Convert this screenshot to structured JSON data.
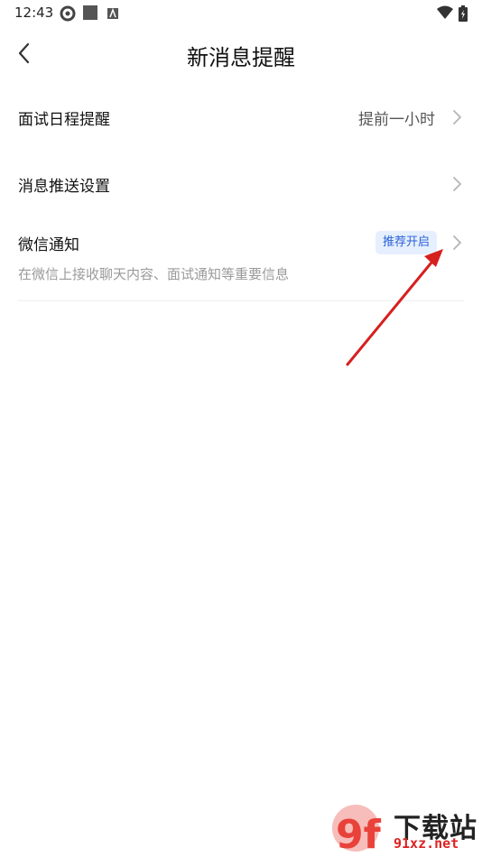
{
  "status_bar": {
    "time": "12:43"
  },
  "header": {
    "title": "新消息提醒"
  },
  "settings": {
    "interview_reminder": {
      "label": "面试日程提醒",
      "value": "提前一小时"
    },
    "push_settings": {
      "label": "消息推送设置"
    },
    "wechat": {
      "label": "微信通知",
      "badge": "推荐开启",
      "description": "在微信上接收聊天内容、面试通知等重要信息"
    }
  },
  "watermark": {
    "brand": "下载站",
    "domain": "91xz.net",
    "logo": "9f"
  },
  "colors": {
    "badge_bg": "#e6effe",
    "badge_text": "#2a62d8",
    "annotation_arrow": "#d61f1f"
  }
}
